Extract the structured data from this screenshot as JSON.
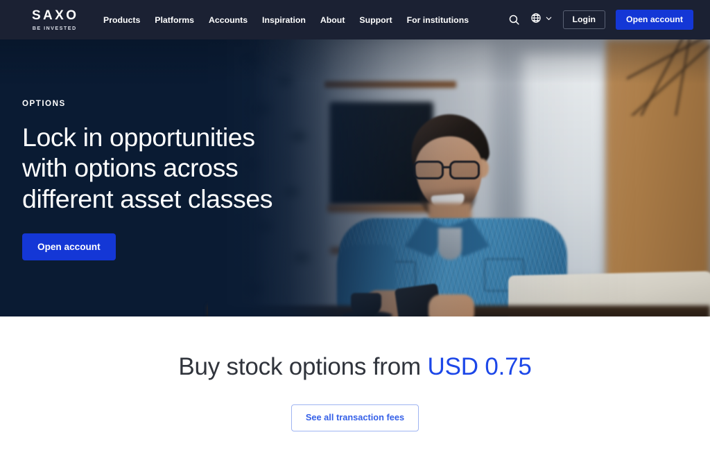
{
  "header": {
    "logo": {
      "name": "SAXO",
      "tagline": "BE INVESTED"
    },
    "nav": [
      {
        "label": "Products"
      },
      {
        "label": "Platforms"
      },
      {
        "label": "Accounts"
      },
      {
        "label": "Inspiration"
      },
      {
        "label": "About"
      },
      {
        "label": "Support"
      },
      {
        "label": "For institutions"
      }
    ],
    "search_icon": "search-icon",
    "language_icon": "globe-icon",
    "language_chevron": "chevron-down-icon",
    "login_label": "Login",
    "open_account_label": "Open account"
  },
  "hero": {
    "eyebrow": "OPTIONS",
    "title_line1": "Lock in opportunities",
    "title_line2": "with options across",
    "title_line3": "different asset classes",
    "cta_label": "Open account",
    "image_alt": "Smiling man in denim shirt using smartphone beside a laptop at a table"
  },
  "fees": {
    "title_prefix": "Buy stock options from",
    "price": "USD 0.75",
    "cta_label": "See all transaction fees"
  },
  "colors": {
    "header_bg": "#1b2133",
    "hero_bg": "#0a1b33",
    "accent_blue": "#1437d6",
    "price_blue": "#1c47e8",
    "link_blue": "#3560e8",
    "text_dark": "#30343c",
    "white": "#ffffff"
  }
}
